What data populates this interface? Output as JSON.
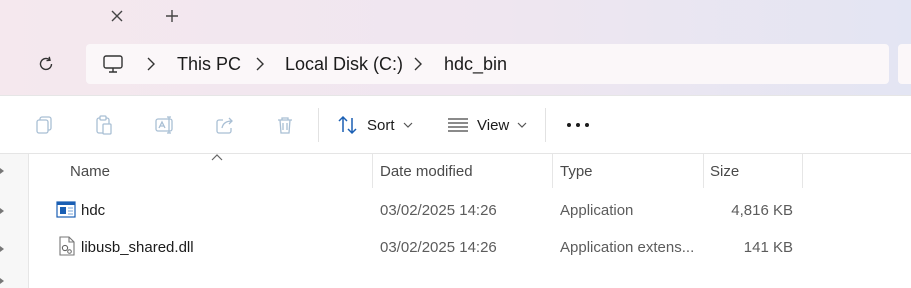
{
  "window": {
    "tab_close_icon": "close-icon",
    "tab_new_icon": "plus-icon"
  },
  "navigation": {
    "refresh_icon": "refresh-icon",
    "breadcrumb": {
      "root_icon": "computer-icon",
      "items": [
        "This PC",
        "Local Disk (C:)",
        "hdc_bin"
      ]
    }
  },
  "toolbar": {
    "icons": [
      "copy-icon",
      "paste-icon",
      "rename-icon",
      "share-icon",
      "delete-icon"
    ],
    "sort_label": "Sort",
    "view_label": "View",
    "more_icon": "more-icon"
  },
  "file_list": {
    "columns": [
      "Name",
      "Date modified",
      "Type",
      "Size"
    ],
    "sorted_column": "Name",
    "rows": [
      {
        "name": "hdc",
        "date": "03/02/2025 14:26",
        "type": "Application",
        "size": "4,816 KB",
        "icon": "application-icon"
      },
      {
        "name": "libusb_shared.dll",
        "date": "03/02/2025 14:26",
        "type": "Application extens...",
        "size": "141 KB",
        "icon": "dll-file-icon"
      }
    ]
  },
  "colors": {
    "title_gradient_start": "#f5e8ee",
    "title_gradient_end": "#e3e5f3",
    "address_bg": "#fbf7f9",
    "accent": "#1a5fb4"
  }
}
